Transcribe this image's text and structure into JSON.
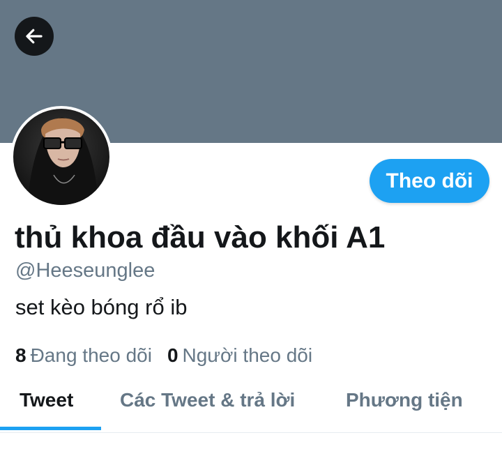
{
  "header": {
    "back_icon": "arrow-left-icon",
    "banner_color": "#657786"
  },
  "profile": {
    "avatar_icon": "profile-photo",
    "display_name": "thủ khoa đầu vào khối A1",
    "handle": "@Heeseunglee",
    "bio": "set kèo bóng rổ ib",
    "follow_button_label": "Theo dõi",
    "accent_color": "#1da1f2"
  },
  "stats": {
    "following_count": "8",
    "following_label": "Đang theo dõi",
    "followers_count": "0",
    "followers_label": "Người theo dõi"
  },
  "tabs": [
    {
      "label": "Tweet",
      "active": true
    },
    {
      "label": "Các Tweet & trả lời",
      "active": false
    },
    {
      "label": "Phương tiện",
      "active": false
    }
  ]
}
